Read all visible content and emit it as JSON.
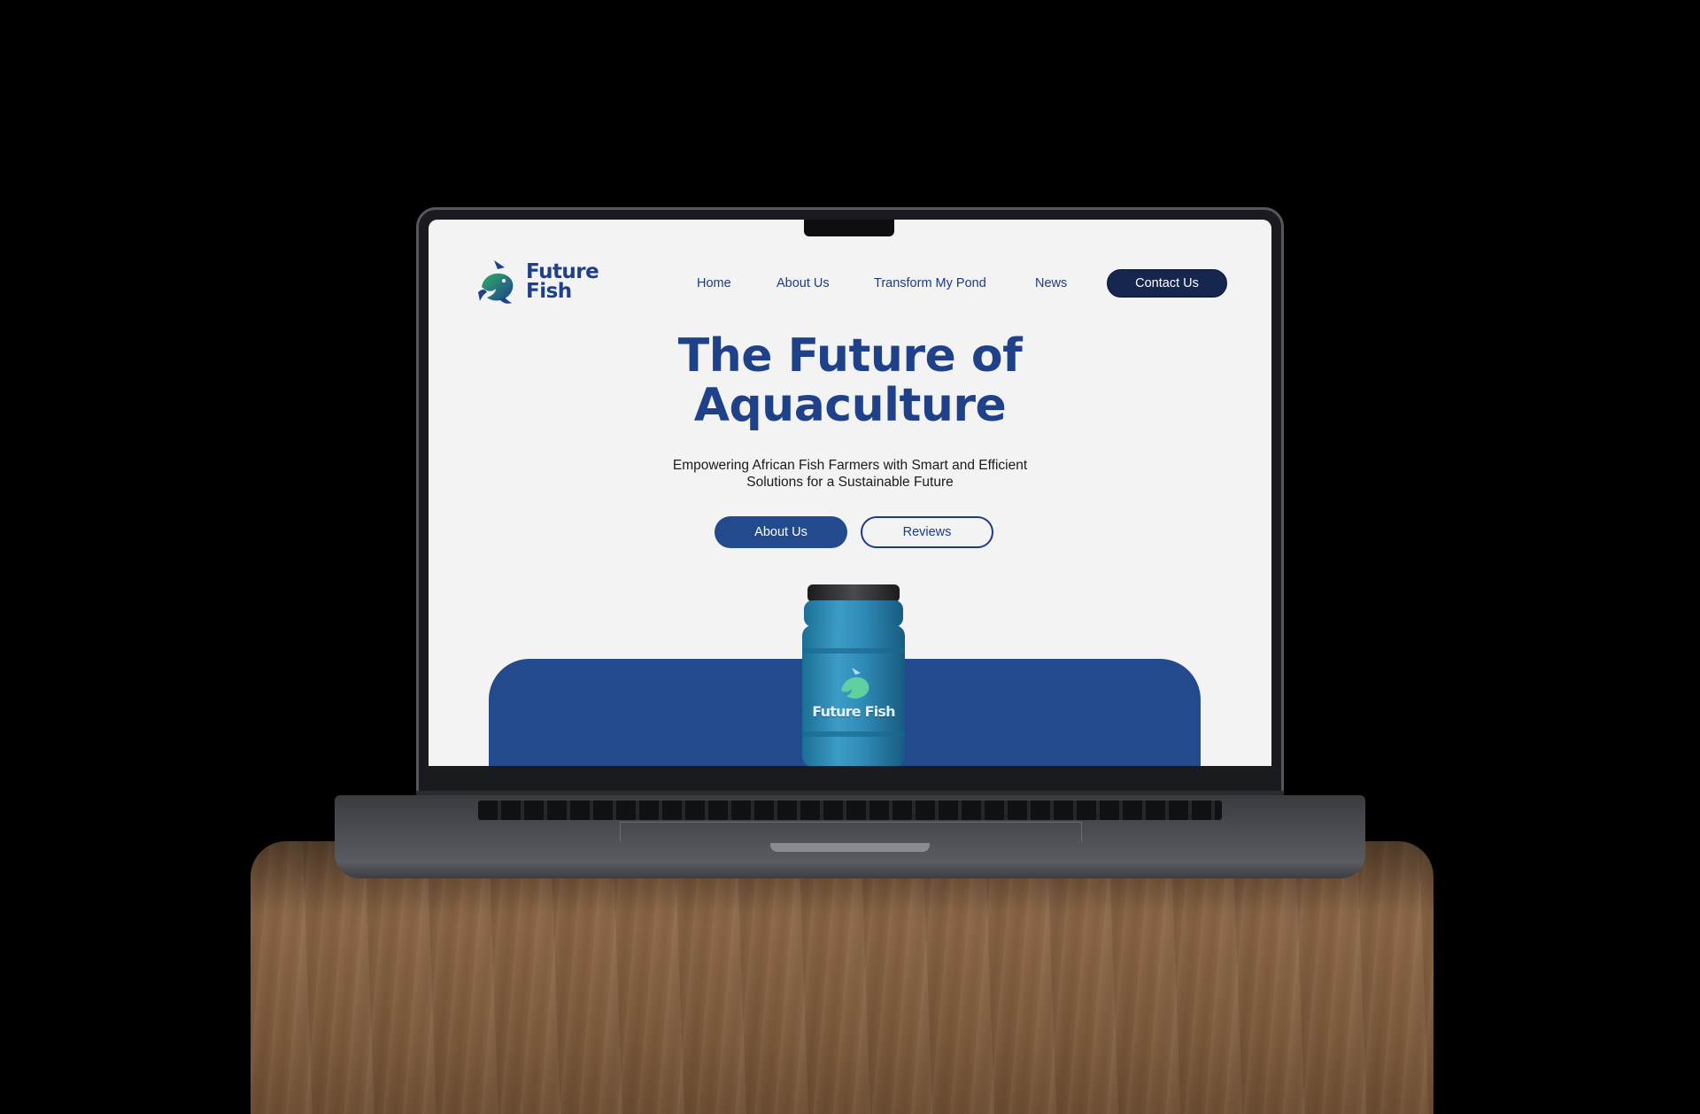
{
  "brand": {
    "name_line1": "Future",
    "name_line2": "Fish",
    "tank_label": "Future Fish"
  },
  "nav": {
    "items": [
      {
        "label": "Home"
      },
      {
        "label": "About Us"
      },
      {
        "label": "Transform My Pond"
      },
      {
        "label": "News"
      }
    ],
    "contact_label": "Contact Us"
  },
  "hero": {
    "title_line1": "The Future of",
    "title_line2": "Aquaculture",
    "subtitle_line1": "Empowering African Fish Farmers with Smart and Efficient",
    "subtitle_line2": "Solutions for a Sustainable Future",
    "primary_button": "About Us",
    "secondary_button": "Reviews"
  },
  "colors": {
    "brand_blue": "#1f4189",
    "navy_button": "#17264f",
    "panel_blue": "#224a8c",
    "brand_green": "#2fae6a",
    "page_background": "#f3f3f4"
  }
}
